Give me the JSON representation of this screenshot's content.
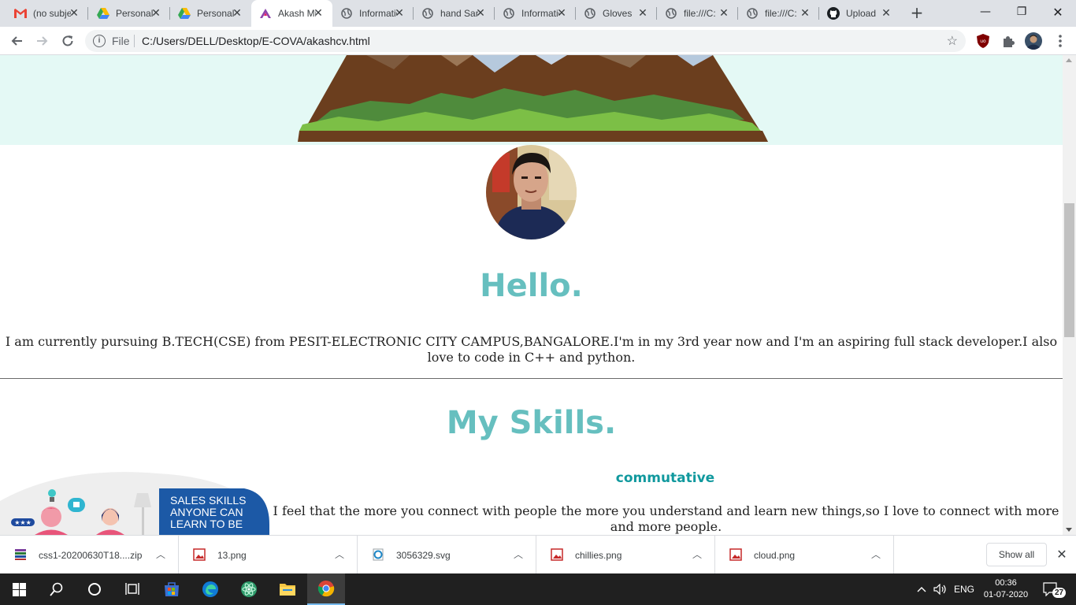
{
  "browser": {
    "tabs": [
      {
        "title": "(no subject)",
        "icon": "gmail-icon"
      },
      {
        "title": "Personal",
        "icon": "drive-icon"
      },
      {
        "title": "Personal",
        "icon": "drive-icon"
      },
      {
        "title": "Akash Mishra",
        "icon": "app-icon"
      },
      {
        "title": "Information",
        "icon": "globe-icon"
      },
      {
        "title": "hand Sanitizer",
        "icon": "globe-icon"
      },
      {
        "title": "Information",
        "icon": "globe-icon"
      },
      {
        "title": "Gloves",
        "icon": "globe-icon"
      },
      {
        "title": "file:///C:",
        "icon": "globe-icon"
      },
      {
        "title": "file:///C:",
        "icon": "globe-icon"
      },
      {
        "title": "Upload",
        "icon": "github-icon"
      }
    ],
    "active_tab_index": 3,
    "new_tab": "+",
    "window_controls": {
      "minimize": "—",
      "restore": "❐",
      "close": "✕"
    },
    "address": {
      "scheme_label": "File",
      "url": "C:/Users/DELL/Desktop/E-COVA/akashcv.html"
    }
  },
  "page": {
    "hello_heading": "Hello.",
    "intro": "I am currently pursuing B.TECH(CSE) from PESIT-ELECTRONIC CITY CAMPUS,BANGALORE.I'm in my 3rd year now and I'm an aspiring full stack developer.I also love to code in C++ and python.",
    "skills_heading": "My Skills.",
    "illustration_text": [
      "SALES SKILLS",
      "ANYONE CAN",
      "LEARN TO BE"
    ],
    "skill": {
      "name": "commutative",
      "description": "I feel that the more you connect with people the more you understand and learn new things,so I love to connect with more and more people."
    },
    "colors": {
      "heading": "#66bfbf",
      "skill_name": "#11999e",
      "hero_bg": "#e4f9f5"
    }
  },
  "downloads": {
    "items": [
      {
        "name": "css1-20200630T18....zip",
        "icon": "archive-icon"
      },
      {
        "name": "13.png",
        "icon": "image-file-icon"
      },
      {
        "name": "3056329.svg",
        "icon": "edge-file-icon"
      },
      {
        "name": "chillies.png",
        "icon": "image-file-icon"
      },
      {
        "name": "cloud.png",
        "icon": "image-file-icon"
      }
    ],
    "show_all": "Show all"
  },
  "taskbar": {
    "language": "ENG",
    "time": "00:36",
    "date": "01-07-2020",
    "notifications": "27"
  }
}
